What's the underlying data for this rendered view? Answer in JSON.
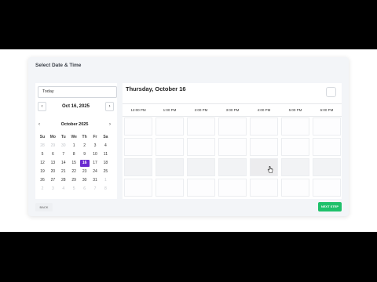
{
  "dialog": {
    "title": "Select Date & Time"
  },
  "left": {
    "today_value": "Today",
    "prev_label": "‹",
    "next_label": "›",
    "current_date": "Oct 16, 2025",
    "calendar": {
      "prev_label": "‹",
      "next_label": "›",
      "month_label": "October 2025",
      "weekdays": [
        "Su",
        "Mo",
        "Tu",
        "We",
        "Th",
        "Fr",
        "Sa"
      ],
      "weeks": [
        [
          "28",
          "29",
          "30",
          "1",
          "2",
          "3",
          "4"
        ],
        [
          "5",
          "6",
          "7",
          "8",
          "9",
          "10",
          "11"
        ],
        [
          "12",
          "13",
          "14",
          "15",
          "16",
          "17",
          "18"
        ],
        [
          "19",
          "20",
          "21",
          "22",
          "23",
          "24",
          "25"
        ],
        [
          "26",
          "27",
          "28",
          "29",
          "30",
          "31",
          "1"
        ],
        [
          "2",
          "3",
          "4",
          "5",
          "6",
          "7",
          "8"
        ]
      ],
      "selected_day": "16"
    }
  },
  "right": {
    "title": "Thursday, October 16",
    "times": [
      "12:00 PM",
      "1:00 PM",
      "2:00 PM",
      "3:00 PM",
      "4:00 PM",
      "5:00 PM",
      "6:00 PM"
    ]
  },
  "footer": {
    "back_label": "BACK",
    "next_label": "NEXT STEP"
  },
  "colors": {
    "accent": "#6a2bd0",
    "next": "#1fc16b"
  }
}
